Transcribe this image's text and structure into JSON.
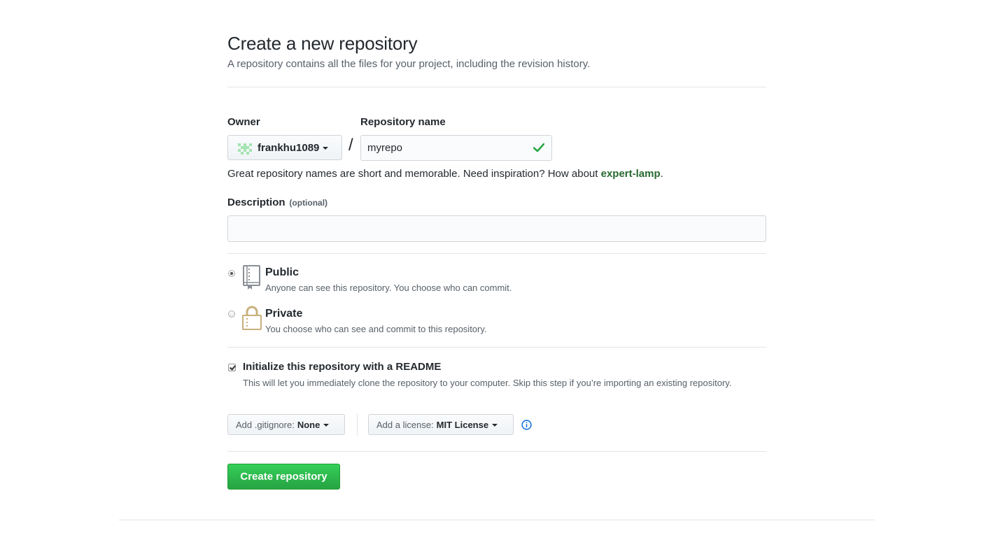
{
  "page": {
    "title": "Create a new repository",
    "subtitle": "A repository contains all the files for your project, including the revision history."
  },
  "owner": {
    "label": "Owner",
    "value": "frankhu1089"
  },
  "repo_name": {
    "label": "Repository name",
    "value": "myrepo",
    "separator": "/"
  },
  "hint": {
    "text": "Great repository names are short and memorable. Need inspiration? How about ",
    "suggestion": "expert-lamp",
    "end": "."
  },
  "description": {
    "label": "Description",
    "optional": "(optional)",
    "value": ""
  },
  "visibility": {
    "public": {
      "title": "Public",
      "desc": "Anyone can see this repository. You choose who can commit.",
      "checked": true
    },
    "private": {
      "title": "Private",
      "desc": "You choose who can see and commit to this repository.",
      "checked": false
    }
  },
  "readme": {
    "title": "Initialize this repository with a README",
    "desc": "This will let you immediately clone the repository to your computer. Skip this step if you’re importing an existing repository.",
    "checked": true
  },
  "gitignore": {
    "prefix": "Add .gitignore:",
    "value": "None"
  },
  "license": {
    "prefix": "Add a license:",
    "value": "MIT License"
  },
  "submit": {
    "label": "Create repository"
  },
  "colors": {
    "primary_green": "#28a745",
    "suggestion_green": "#28692f",
    "check_green": "#28a745",
    "info_blue": "#0366d6",
    "lock_gold": "#c8b07c"
  }
}
